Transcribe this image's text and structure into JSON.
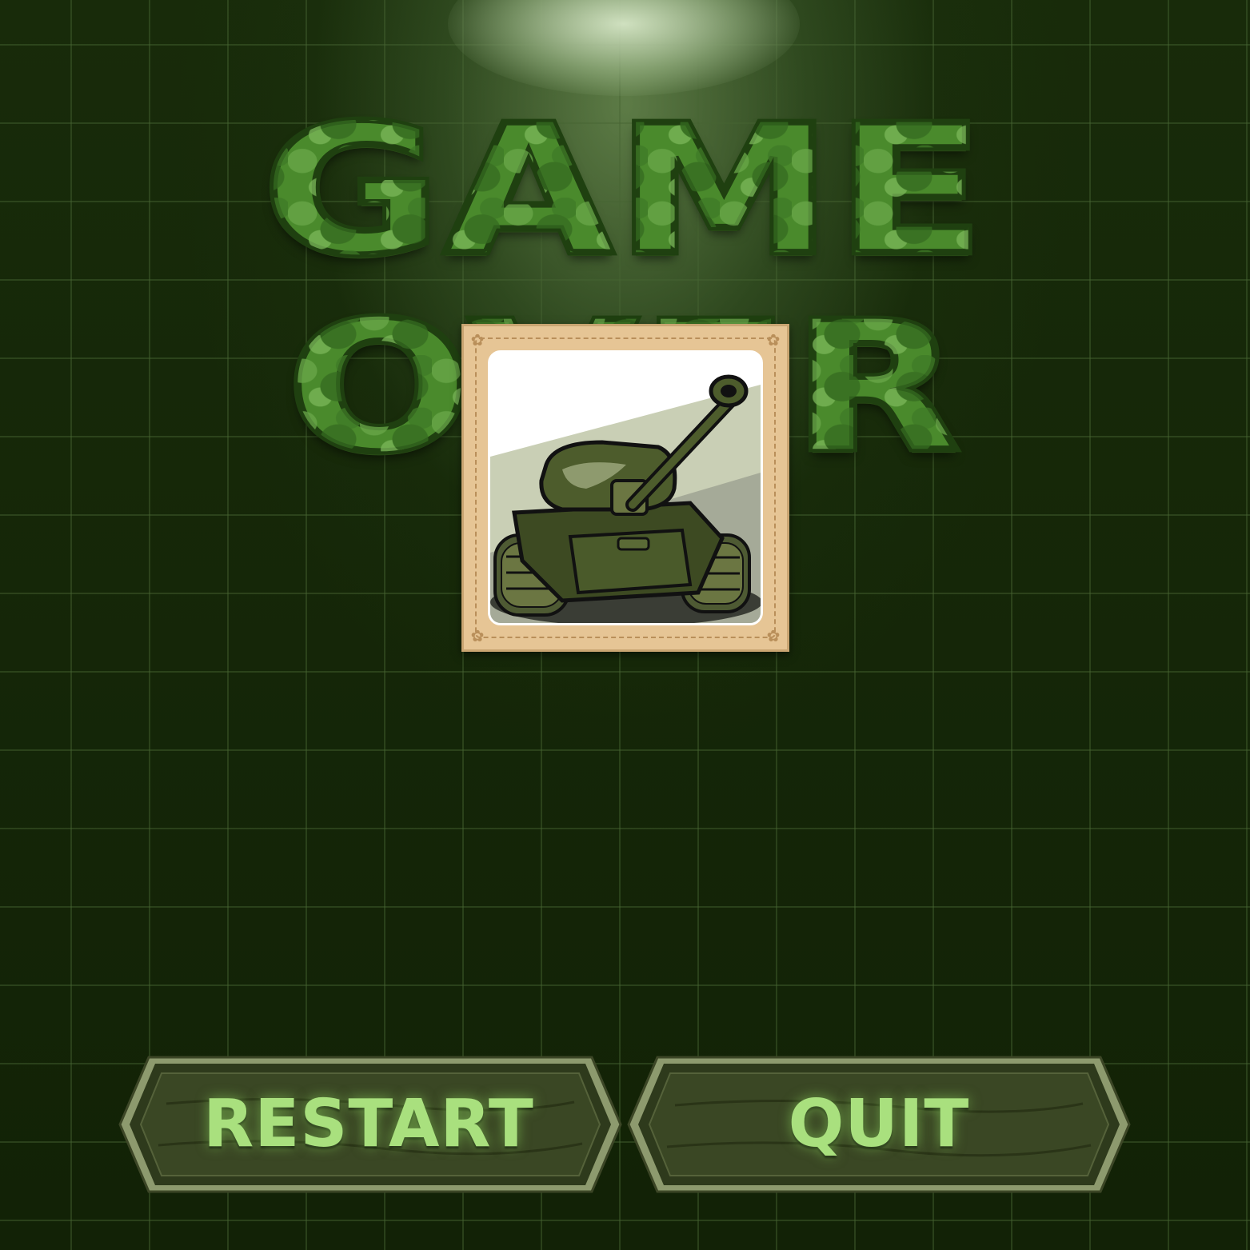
{
  "screen": {
    "title": "GAME OVER"
  },
  "portrait": {
    "icon": "tank-illustration"
  },
  "buttons": {
    "restart_label": "RESTART",
    "quit_label": "QUIT"
  },
  "colors": {
    "background": "#142408",
    "title_green": "#4a8a2c",
    "button_text": "#a9e07e",
    "frame": "#e6c595"
  }
}
